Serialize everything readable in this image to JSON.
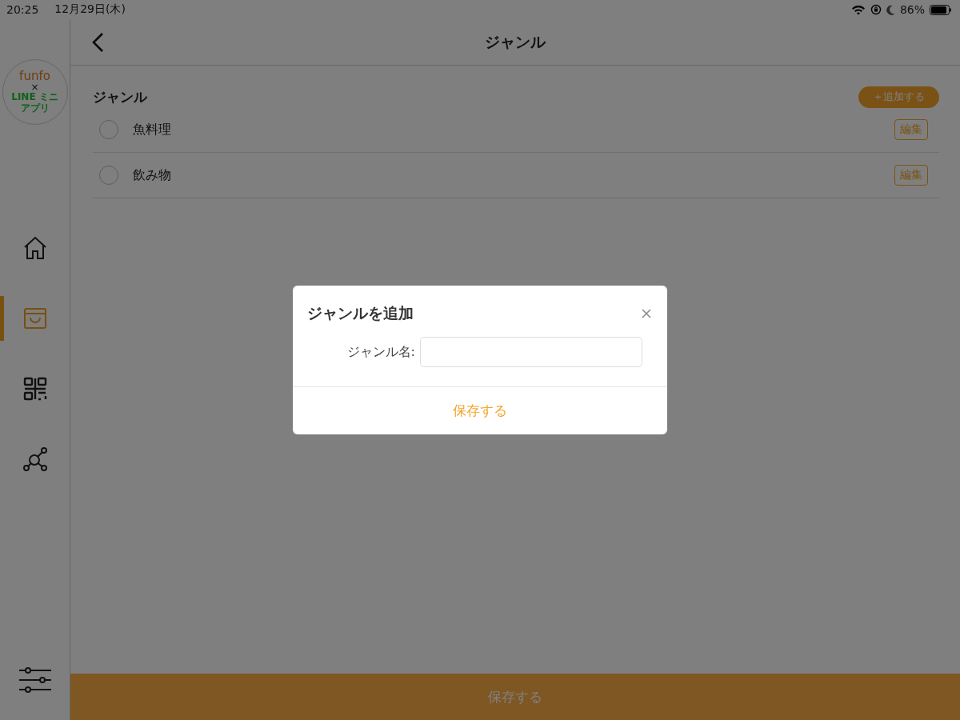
{
  "status_bar": {
    "time": "20:25",
    "date": "12月29日(木)",
    "battery": "86%"
  },
  "sidebar": {
    "logo": {
      "brand": "funfo",
      "cross": "×",
      "sub": "LINE ミニアプリ"
    },
    "items": [
      {
        "kind": "home",
        "selected": false
      },
      {
        "kind": "shop",
        "selected": true
      },
      {
        "kind": "qr",
        "selected": false
      },
      {
        "kind": "network",
        "selected": false
      }
    ]
  },
  "header": {
    "title": "ジャンル"
  },
  "genres": {
    "heading": "ジャンル",
    "add_button": "＋追加する",
    "items": [
      {
        "name": "魚料理",
        "selected": false,
        "edit": "編集"
      },
      {
        "name": "飲み物",
        "selected": false,
        "edit": "編集"
      }
    ]
  },
  "footer_button": "保存する",
  "dialog": {
    "title": "ジャンルを追加",
    "field_label": "ジャンル名:",
    "save_button": "保存する"
  }
}
